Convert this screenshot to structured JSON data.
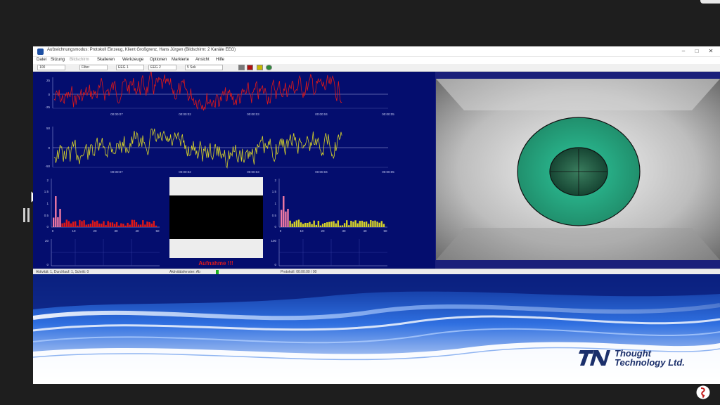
{
  "window": {
    "title": "Aufzeichnungsmodus: Protokoll Einzeug, Klient Großgrenz, Hans Jürgen (Bildschirm: 2 Kanäle EEG)",
    "controls": {
      "minimize": "–",
      "maximize": "□",
      "close": "✕"
    }
  },
  "menu": {
    "items": [
      {
        "label": "Datei",
        "enabled": true
      },
      {
        "label": "Sitzung",
        "enabled": true
      },
      {
        "label": "Bildschirm",
        "enabled": false
      },
      {
        "label": "Skalieren",
        "enabled": true
      },
      {
        "label": "Werkzeuge",
        "enabled": true
      },
      {
        "label": "Optionen",
        "enabled": true
      },
      {
        "label": "Markierte",
        "enabled": true
      },
      {
        "label": "Ansicht",
        "enabled": true
      },
      {
        "label": "Hilfe",
        "enabled": true
      }
    ]
  },
  "toolbar": {
    "combos": [
      "100",
      "Filter",
      "EEG 1",
      "EEG 2",
      "5 Sek"
    ],
    "button_colors": [
      "#7a7a7a",
      "#b01010",
      "#c8b800",
      "#2d8a3a"
    ]
  },
  "graphs": {
    "trace1": {
      "color": "#e01818",
      "y_ticks": [
        "25",
        "0",
        "-25"
      ],
      "x_ticks": [
        "00:00:07",
        "00:00:02",
        "00:00:03",
        "00:00:04",
        "00:00:05"
      ]
    },
    "trace2": {
      "color": "#d6d22a",
      "y_ticks": [
        "50",
        "0",
        "-50"
      ],
      "x_ticks": [
        "00:00:07",
        "00:00:02",
        "00:00:03",
        "00:00:04",
        "00:00:05"
      ]
    },
    "spectrum_left": {
      "color": "#e01818",
      "y_ticks": [
        "2",
        "1.5",
        "1",
        "0.5",
        "0"
      ],
      "x_ticks": [
        "0",
        "10",
        "20",
        "30",
        "40",
        "50"
      ]
    },
    "spectrum_right": {
      "color": "#d6d22a",
      "y_ticks": [
        "2",
        "1.5",
        "1",
        "0.5",
        "0"
      ],
      "x_ticks": [
        "0",
        "10",
        "20",
        "30",
        "40",
        "50"
      ]
    },
    "small_left": {
      "y_ticks": [
        "20",
        "0"
      ]
    },
    "small_right": {
      "y_ticks": [
        "100",
        "0"
      ]
    }
  },
  "center_display": {
    "caption": "Aufnahme !!!",
    "caption_color": "#e11b1b"
  },
  "video": {
    "outer_color": "#2ec79c",
    "inner_color": "#1f8a68"
  },
  "status": {
    "left": "Aktivität: 1, Durchlauf: 1, Schritt: 0",
    "middle": "Aktivitätsfenster: Ab",
    "right": "Protokoll: 00:00:00 / 00"
  },
  "brand": {
    "name": "Thought\nTechnology Ltd.",
    "color": "#1b2f6b"
  }
}
